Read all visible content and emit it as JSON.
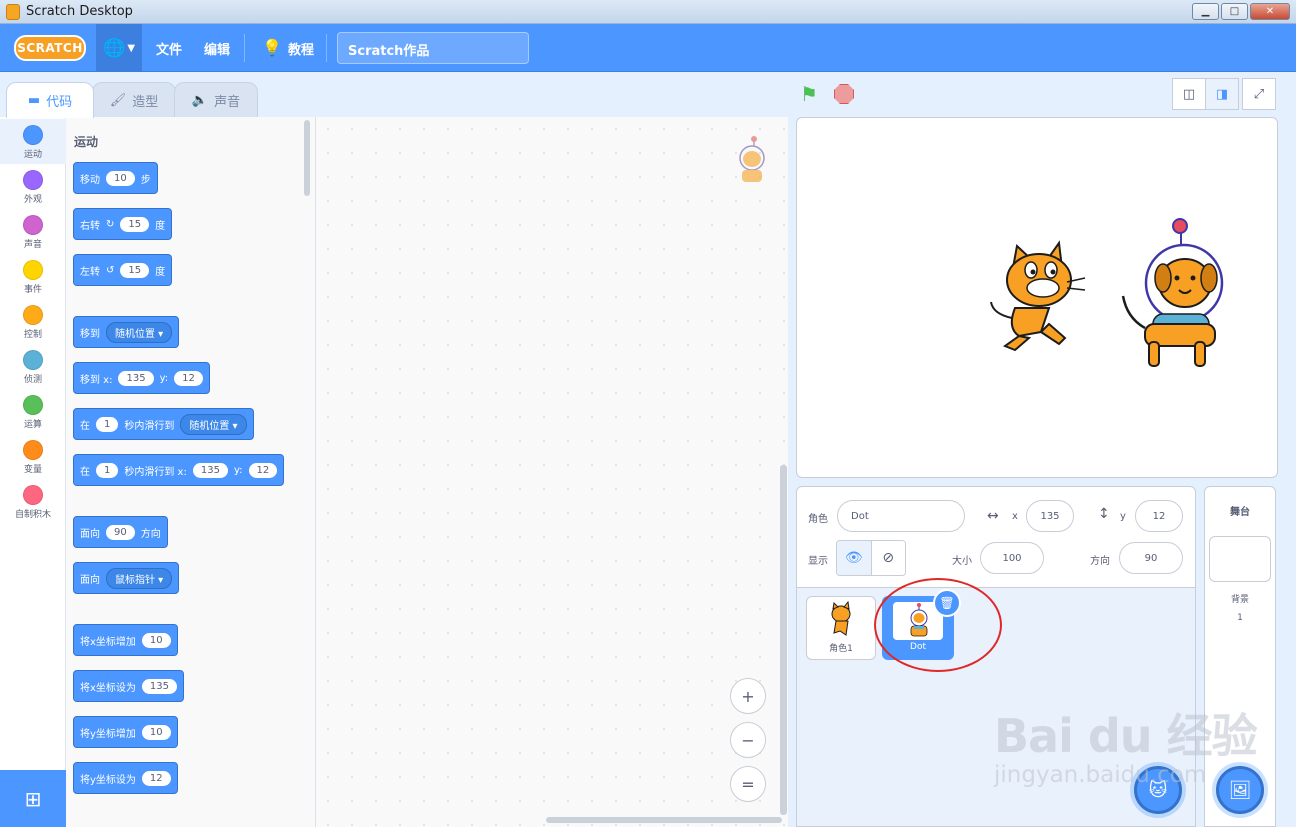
{
  "window": {
    "title": "Scratch Desktop",
    "minimize": "▁",
    "maximize": "□",
    "close": "✕"
  },
  "menubar": {
    "logo": "SCRATCH",
    "language_icon": "globe-icon",
    "file": "文件",
    "edit": "编辑",
    "tutorials": "教程",
    "project_title": "Scratch作品"
  },
  "tabs": [
    {
      "label": "代码",
      "icon": "code-icon",
      "active": true
    },
    {
      "label": "造型",
      "icon": "brush-icon",
      "active": false
    },
    {
      "label": "声音",
      "icon": "speaker-icon",
      "active": false
    }
  ],
  "categories": [
    {
      "label": "运动",
      "color": "#4c97ff",
      "active": true
    },
    {
      "label": "外观",
      "color": "#9966ff"
    },
    {
      "label": "声音",
      "color": "#cf63cf"
    },
    {
      "label": "事件",
      "color": "#ffd500"
    },
    {
      "label": "控制",
      "color": "#ffab19"
    },
    {
      "label": "侦测",
      "color": "#5cb1d6"
    },
    {
      "label": "运算",
      "color": "#59c059"
    },
    {
      "label": "变量",
      "color": "#ff8c1a"
    },
    {
      "label": "自制积木",
      "color": "#ff6680"
    }
  ],
  "palette": {
    "section_title": "运动",
    "blocks": {
      "move": {
        "a": "移动",
        "v": "10",
        "b": "步"
      },
      "turn_right": {
        "a": "右转",
        "v": "15",
        "b": "度"
      },
      "turn_left": {
        "a": "左转",
        "v": "15",
        "b": "度"
      },
      "goto": {
        "a": "移到",
        "dd": "随机位置"
      },
      "goto_xy": {
        "a": "移到 x:",
        "x": "135",
        "b": "y:",
        "y": "12"
      },
      "glide": {
        "a": "在",
        "v": "1",
        "b": "秒内滑行到",
        "dd": "随机位置"
      },
      "glide_xy": {
        "a": "在",
        "v": "1",
        "b": "秒内滑行到 x:",
        "x": "135",
        "c": "y:",
        "y": "12"
      },
      "point_dir": {
        "a": "面向",
        "v": "90",
        "b": "方向"
      },
      "point_towards": {
        "a": "面向",
        "dd": "鼠标指针"
      },
      "change_x": {
        "a": "将x坐标增加",
        "v": "10"
      },
      "set_x": {
        "a": "将x坐标设为",
        "v": "135"
      },
      "change_y": {
        "a": "将y坐标增加",
        "v": "10"
      },
      "set_y": {
        "a": "将y坐标设为",
        "v": "12"
      }
    }
  },
  "script_area": {
    "zoom_in": "+",
    "zoom_out": "−",
    "zoom_reset": "="
  },
  "sprite_info": {
    "sprite_label": "角色",
    "sprite_name": "Dot",
    "x_label": "x",
    "x_value": "135",
    "y_label": "y",
    "y_value": "12",
    "show_label": "显示",
    "size_label": "大小",
    "size_value": "100",
    "direction_label": "方向",
    "direction_value": "90"
  },
  "sprites": [
    {
      "name": "角色1",
      "selected": false
    },
    {
      "name": "Dot",
      "selected": true
    }
  ],
  "stage_panel": {
    "header": "舞台",
    "backdrops_label": "背景",
    "backdrops_count": "1"
  },
  "watermark": {
    "line1": "Bai du 经验",
    "line2": "jingyan.baidu.com"
  }
}
